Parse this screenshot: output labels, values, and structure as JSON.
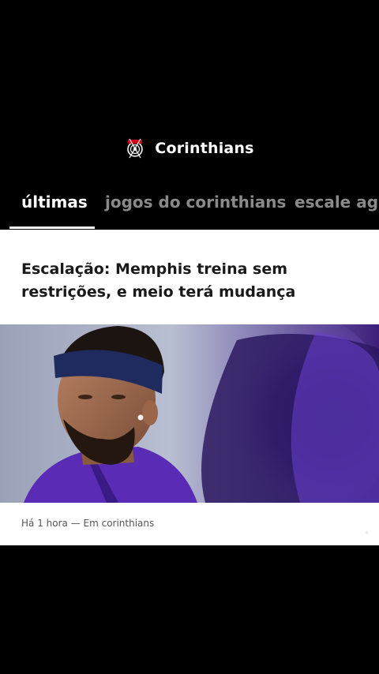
{
  "header": {
    "title": "Corinthians",
    "logo_icon": "corinthians-crest-icon"
  },
  "tabs": [
    {
      "label": "últimas",
      "active": true
    },
    {
      "label": "jogos do corinthians",
      "active": false
    },
    {
      "label": "escale ag",
      "active": false
    }
  ],
  "article": {
    "headline_line1": "Escalação: Memphis treina sem",
    "headline_line2": "restrições, e meio terá mudança",
    "meta": "Há 1 hora — Em corinthians"
  },
  "colors": {
    "background": "#000000",
    "card": "#ffffff",
    "tab_active": "#ffffff",
    "tab_inactive": "#8a8a8a",
    "kit_purple": "#6a2fd1"
  }
}
